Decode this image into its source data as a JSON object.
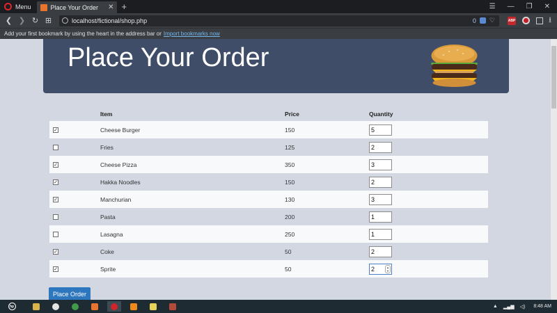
{
  "browser": {
    "menu_label": "Menu",
    "tab_title": "Place Your Order",
    "url": "localhost/fictional/shop.php",
    "blocked_count": "0",
    "bookmarks_hint": "Add your first bookmark by using the heart in the address bar or",
    "bookmarks_link": "Import bookmarks now",
    "extension_abp": "ABP"
  },
  "page": {
    "title": "Place Your Order",
    "table": {
      "headers": {
        "item": "Item",
        "price": "Price",
        "quantity": "Quantity"
      },
      "rows": [
        {
          "checked": true,
          "item": "Cheese Burger",
          "price": "150",
          "quantity": "5"
        },
        {
          "checked": false,
          "item": "Fries",
          "price": "125",
          "quantity": "2"
        },
        {
          "checked": true,
          "item": "Cheese Pizza",
          "price": "350",
          "quantity": "3"
        },
        {
          "checked": true,
          "item": "Hakka Noodles",
          "price": "150",
          "quantity": "2"
        },
        {
          "checked": true,
          "item": "Manchurian",
          "price": "130",
          "quantity": "3"
        },
        {
          "checked": false,
          "item": "Pasta",
          "price": "200",
          "quantity": "1"
        },
        {
          "checked": false,
          "item": "Lasagna",
          "price": "250",
          "quantity": "1"
        },
        {
          "checked": true,
          "item": "Coke",
          "price": "50",
          "quantity": "2"
        },
        {
          "checked": true,
          "item": "Sprite",
          "price": "50",
          "quantity": "2"
        }
      ]
    },
    "submit_label": "Place Order"
  },
  "taskbar": {
    "start_label": "hp",
    "time": "8:48 AM",
    "apps": [
      {
        "name": "file-explorer",
        "color": "#d9b44a"
      },
      {
        "name": "steam",
        "color": "#e4e4e4"
      },
      {
        "name": "chrome",
        "color": "#3f9b4a"
      },
      {
        "name": "xampp",
        "color": "#e8742d"
      },
      {
        "name": "opera",
        "color": "#d0252b"
      },
      {
        "name": "vlc",
        "color": "#f08a1c"
      },
      {
        "name": "notes",
        "color": "#e6d35a"
      },
      {
        "name": "app",
        "color": "#b44a3a"
      }
    ]
  }
}
